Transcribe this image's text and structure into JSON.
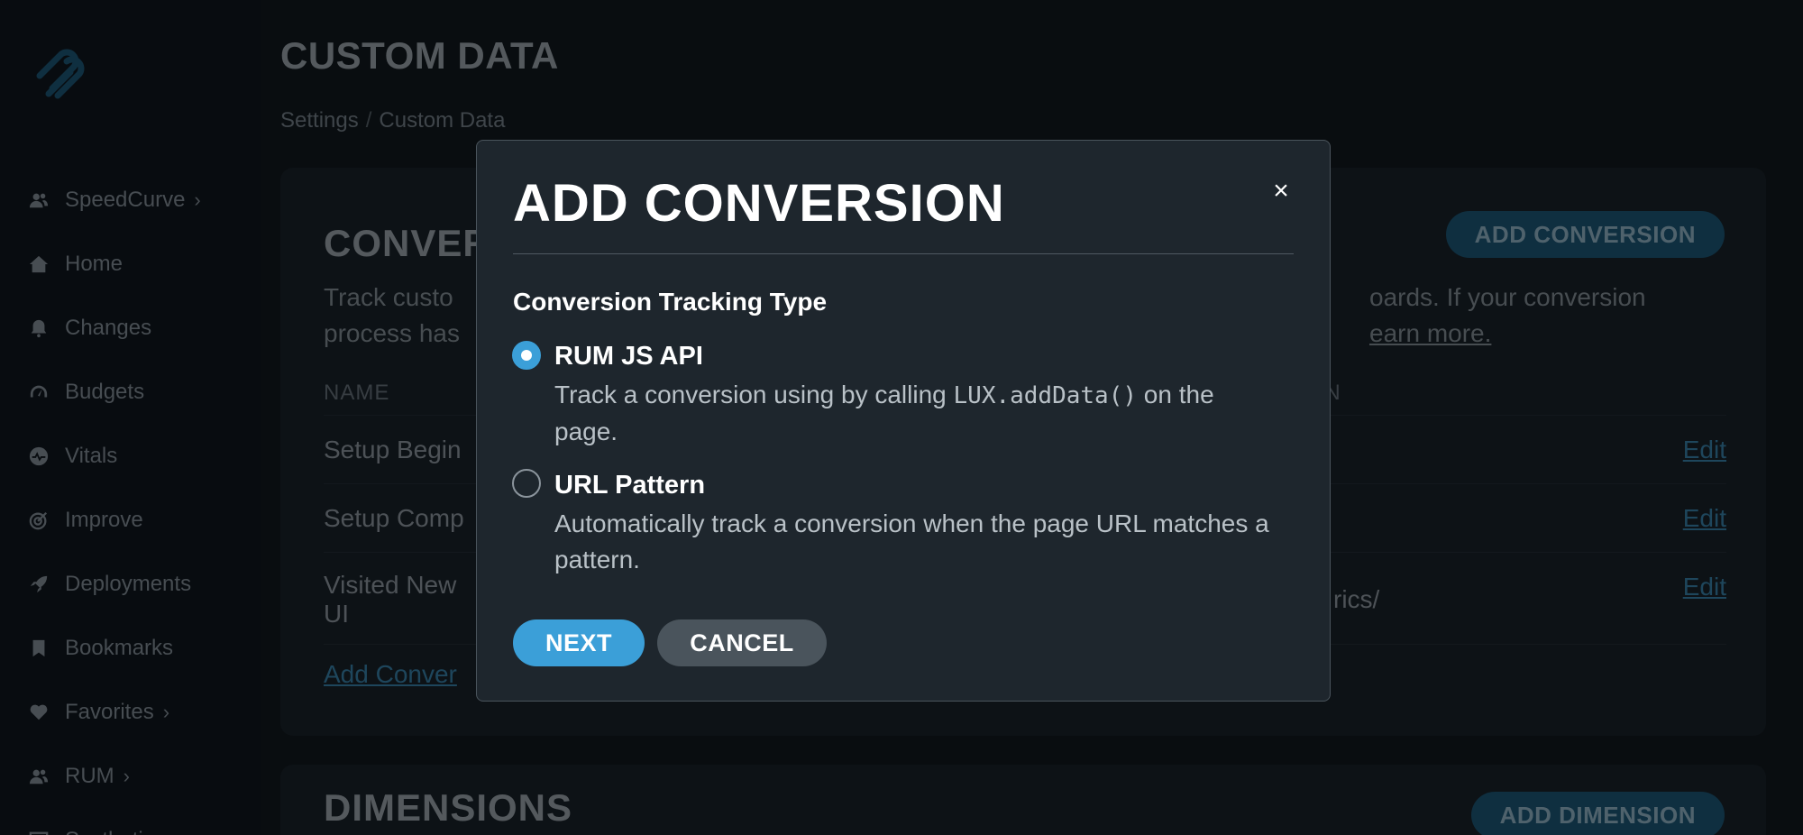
{
  "sidebar": {
    "items": [
      {
        "label": "SpeedCurve",
        "icon": "users-icon",
        "chevron": "›"
      },
      {
        "label": "Home",
        "icon": "home-icon",
        "chevron": ""
      },
      {
        "label": "Changes",
        "icon": "bell-icon",
        "chevron": ""
      },
      {
        "label": "Budgets",
        "icon": "gauge-icon",
        "chevron": ""
      },
      {
        "label": "Vitals",
        "icon": "pulse-icon",
        "chevron": ""
      },
      {
        "label": "Improve",
        "icon": "target-icon",
        "chevron": ""
      },
      {
        "label": "Deployments",
        "icon": "rocket-icon",
        "chevron": ""
      },
      {
        "label": "Bookmarks",
        "icon": "bookmark-icon",
        "chevron": ""
      },
      {
        "label": "Favorites",
        "icon": "heart-icon",
        "chevron": "›"
      },
      {
        "label": "RUM",
        "icon": "users-icon",
        "chevron": "›"
      },
      {
        "label": "Synthetic",
        "icon": "monitor-icon",
        "chevron": "›"
      }
    ]
  },
  "header": {
    "title": "CUSTOM DATA",
    "breadcrumb": [
      "Settings",
      "Custom Data"
    ],
    "breadcrumb_sep": "/"
  },
  "conversions_card": {
    "title": "CONVER",
    "add_button": "ADD CONVERSION",
    "desc_left_1": "Track custo",
    "desc_left_2": "process has",
    "desc_right_1": "oards. If your conversion",
    "desc_right_2": "earn more.",
    "col_name": "NAME",
    "col_pattern": "RN",
    "rows": [
      {
        "name": "Setup Begin",
        "pattern": "",
        "edit": "Edit"
      },
      {
        "name": "Setup Comp",
        "pattern": "",
        "edit": "Edit"
      },
      {
        "name": "Visited New",
        "name2": "UI",
        "pattern": "rics/",
        "edit": "Edit"
      }
    ],
    "add_link": "Add Conver"
  },
  "dimensions_card": {
    "title": "DIMENSIONS",
    "add_button": "ADD DIMENSION"
  },
  "modal": {
    "title": "ADD CONVERSION",
    "close": "×",
    "section_label": "Conversion Tracking Type",
    "options": [
      {
        "title": "RUM JS API",
        "desc_before": "Track a conversion using by calling ",
        "desc_code": "LUX.addData()",
        "desc_after": " on the page.",
        "checked": true
      },
      {
        "title": "URL Pattern",
        "desc": "Automatically track a conversion when the page URL matches a pattern.",
        "checked": false
      }
    ],
    "next_button": "NEXT",
    "cancel_button": "CANCEL"
  },
  "colors": {
    "accent": "#3b9fd8",
    "background": "#121a21",
    "modal_bg": "#1e262d",
    "link": "#3d8db8"
  }
}
